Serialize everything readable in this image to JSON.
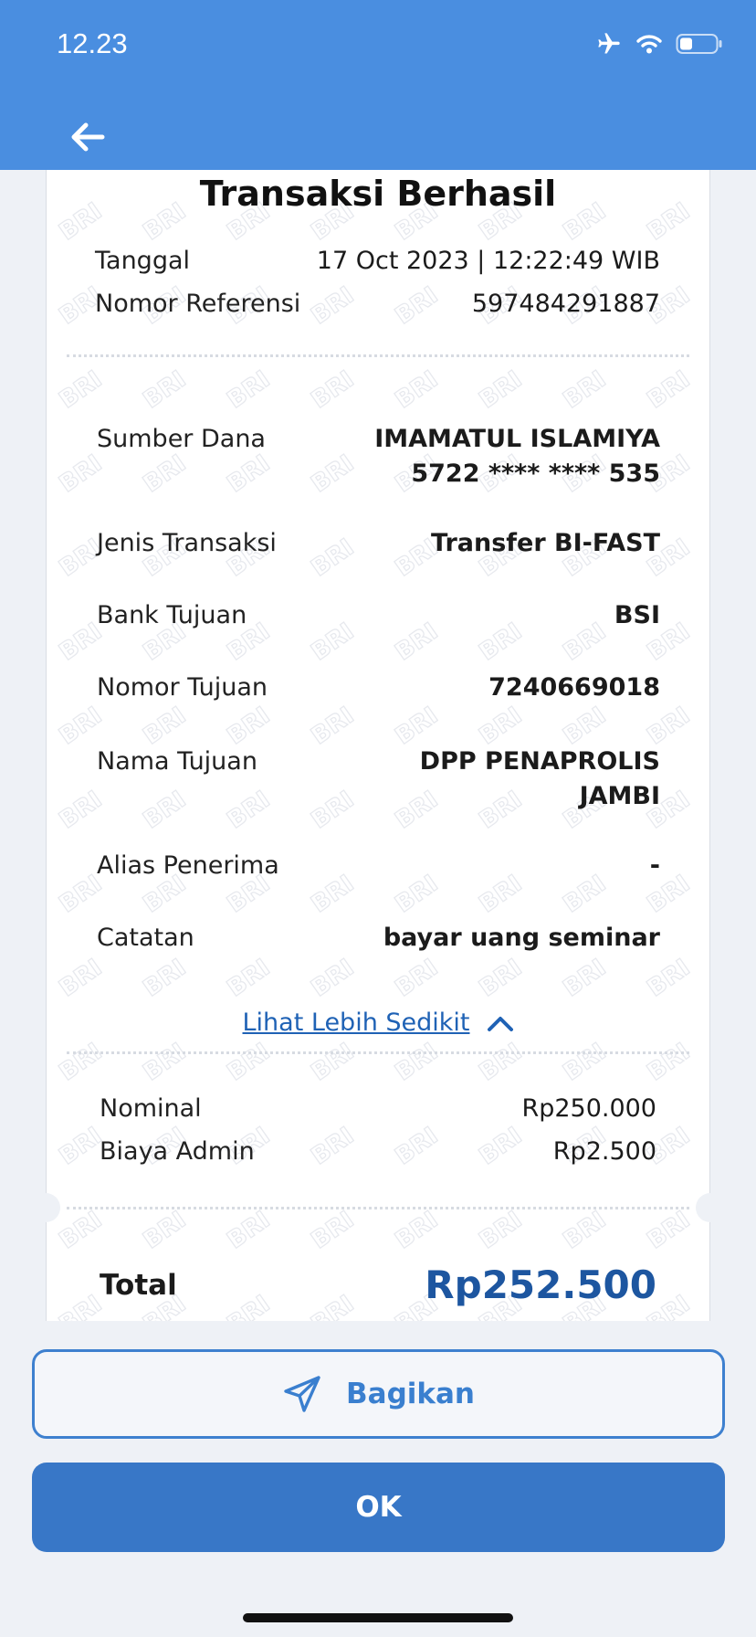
{
  "status_bar": {
    "time": "12.23"
  },
  "receipt": {
    "title": "Transaksi Berhasil",
    "meta": [
      {
        "label": "Tanggal",
        "value": "17 Oct 2023 | 12:22:49 WIB"
      },
      {
        "label": "Nomor Referensi",
        "value": "597484291887"
      }
    ],
    "details": {
      "sumber_dana": {
        "label": "Sumber Dana",
        "name": "IMAMATUL ISLAMIYA",
        "account": "5722 **** **** 535"
      },
      "jenis_transaksi": {
        "label": "Jenis Transaksi",
        "value": "Transfer BI-FAST"
      },
      "bank_tujuan": {
        "label": "Bank Tujuan",
        "value": "BSI"
      },
      "nomor_tujuan": {
        "label": "Nomor Tujuan",
        "value": "7240669018"
      },
      "nama_tujuan": {
        "label": "Nama Tujuan",
        "line1": "DPP PENAPROLIS",
        "line2": "JAMBI"
      },
      "alias_penerima": {
        "label": "Alias Penerima",
        "value": "-"
      },
      "catatan": {
        "label": "Catatan",
        "value": "bayar uang seminar"
      }
    },
    "toggle_label": "Lihat Lebih Sedikit",
    "amounts": [
      {
        "label": "Nominal",
        "value": "Rp250.000"
      },
      {
        "label": "Biaya Admin",
        "value": "Rp2.500"
      }
    ],
    "total": {
      "label": "Total",
      "value": "Rp252.500"
    }
  },
  "buttons": {
    "share": "Bagikan",
    "ok": "OK"
  },
  "icons": {
    "back": "arrow-left-icon",
    "share": "send-icon",
    "toggle": "chevron-up-icon",
    "status": [
      "airplane-icon",
      "wifi-icon",
      "battery-icon"
    ]
  },
  "colors": {
    "header": "#4a8ee0",
    "primary_button": "#3877c7",
    "total_text": "#1d56a0",
    "link": "#1f62b5",
    "background": "#eef1f6"
  }
}
